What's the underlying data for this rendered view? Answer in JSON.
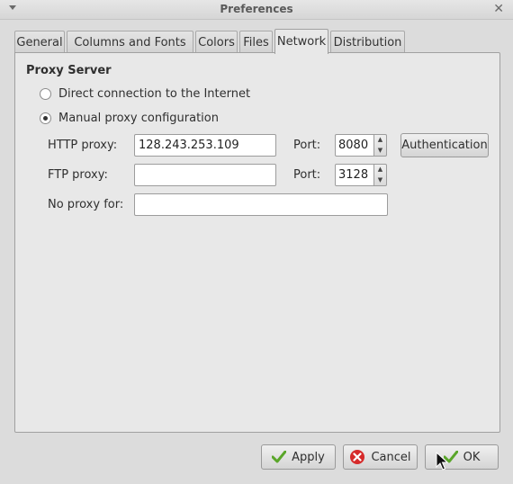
{
  "window": {
    "title": "Preferences"
  },
  "tabs": [
    {
      "label": "General"
    },
    {
      "label": "Columns and Fonts"
    },
    {
      "label": "Colors"
    },
    {
      "label": "Files"
    },
    {
      "label": "Network",
      "active": true
    },
    {
      "label": "Distribution"
    }
  ],
  "proxy": {
    "section_title": "Proxy Server",
    "options": [
      {
        "label": "Direct connection to the Internet",
        "checked": false
      },
      {
        "label": "Manual proxy configuration",
        "checked": true
      }
    ],
    "http": {
      "label": "HTTP proxy:",
      "value": "128.243.253.109",
      "port_label": "Port:",
      "port": "8080"
    },
    "ftp": {
      "label": "FTP proxy:",
      "value": "",
      "port_label": "Port:",
      "port": "3128"
    },
    "no_proxy": {
      "label": "No proxy for:",
      "value": ""
    },
    "auth_button": "Authentication"
  },
  "footer": {
    "apply": "Apply",
    "cancel": "Cancel",
    "ok": "OK"
  },
  "icons": {
    "menu": "chevron-down-icon",
    "close": "close-icon",
    "apply": "checkmark-icon",
    "cancel": "cancel-icon",
    "ok": "checkmark-icon"
  },
  "colors": {
    "check_green": "#5aa62a",
    "cancel_red": "#d62a2a"
  }
}
